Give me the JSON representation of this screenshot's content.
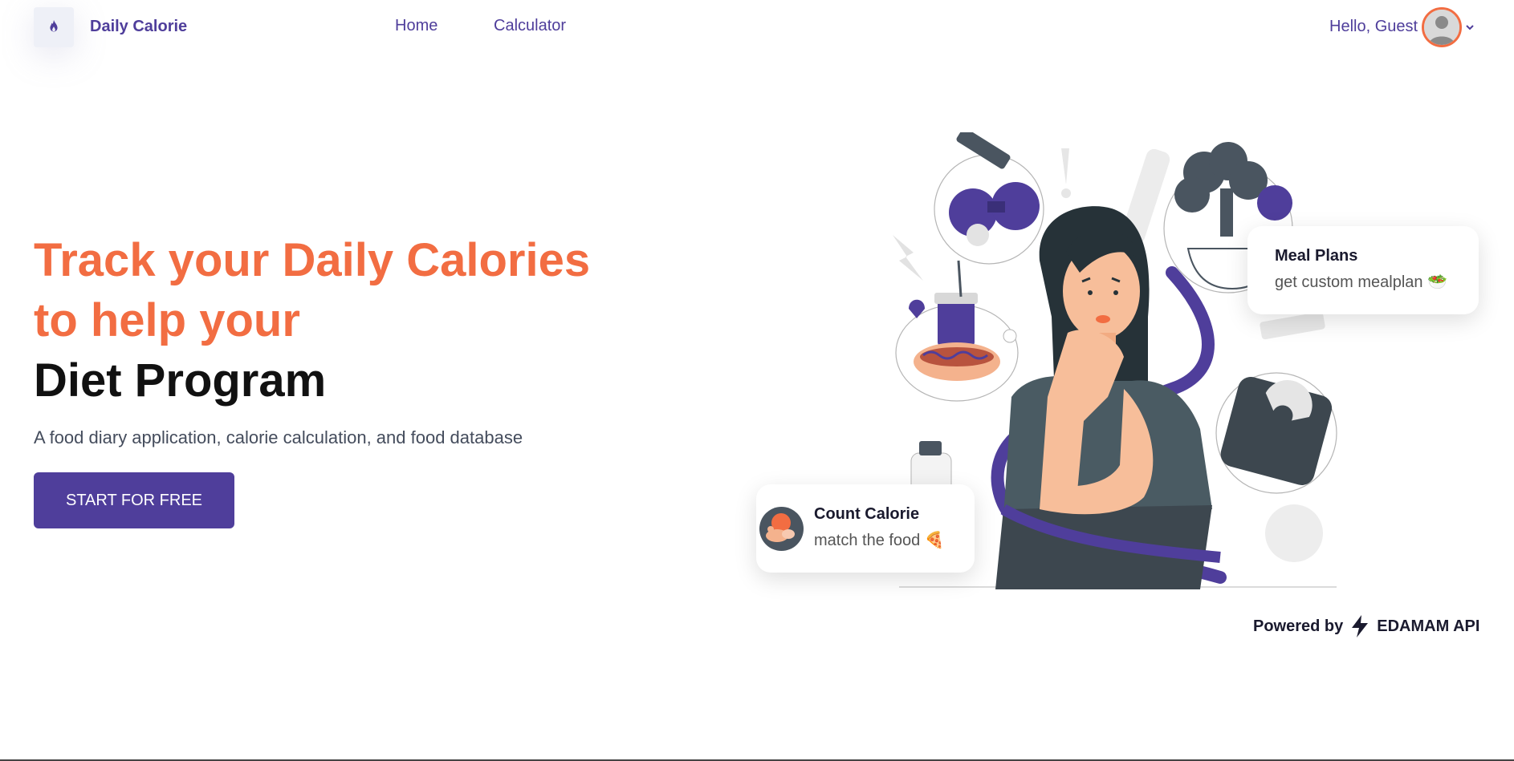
{
  "nav": {
    "brand": "Daily Calorie",
    "links": [
      "Home",
      "Calculator"
    ],
    "greeting": "Hello, Guest"
  },
  "hero": {
    "title_line1": "Track your Daily Calories",
    "title_line2": "to help your",
    "title_line3": "Diet Program",
    "subtitle": "A food diary application, calorie calculation, and food database",
    "cta": "START FOR FREE"
  },
  "cards": {
    "meal": {
      "title": "Meal Plans",
      "subtitle": "get custom mealplan 🥗"
    },
    "count": {
      "title": "Count Calorie",
      "subtitle": "match the food 🍕"
    }
  },
  "footer": {
    "powered_by": "Powered by",
    "api": "EDAMAM API"
  },
  "colors": {
    "primary": "#4f3e9b",
    "accent": "#f26d42",
    "text_dark": "#111111",
    "muted": "#444c5c"
  },
  "icons": {
    "logo": "flame-icon",
    "avatar": "user-avatar-icon",
    "chevron": "chevron-down-icon",
    "bolt": "lightning-icon"
  }
}
